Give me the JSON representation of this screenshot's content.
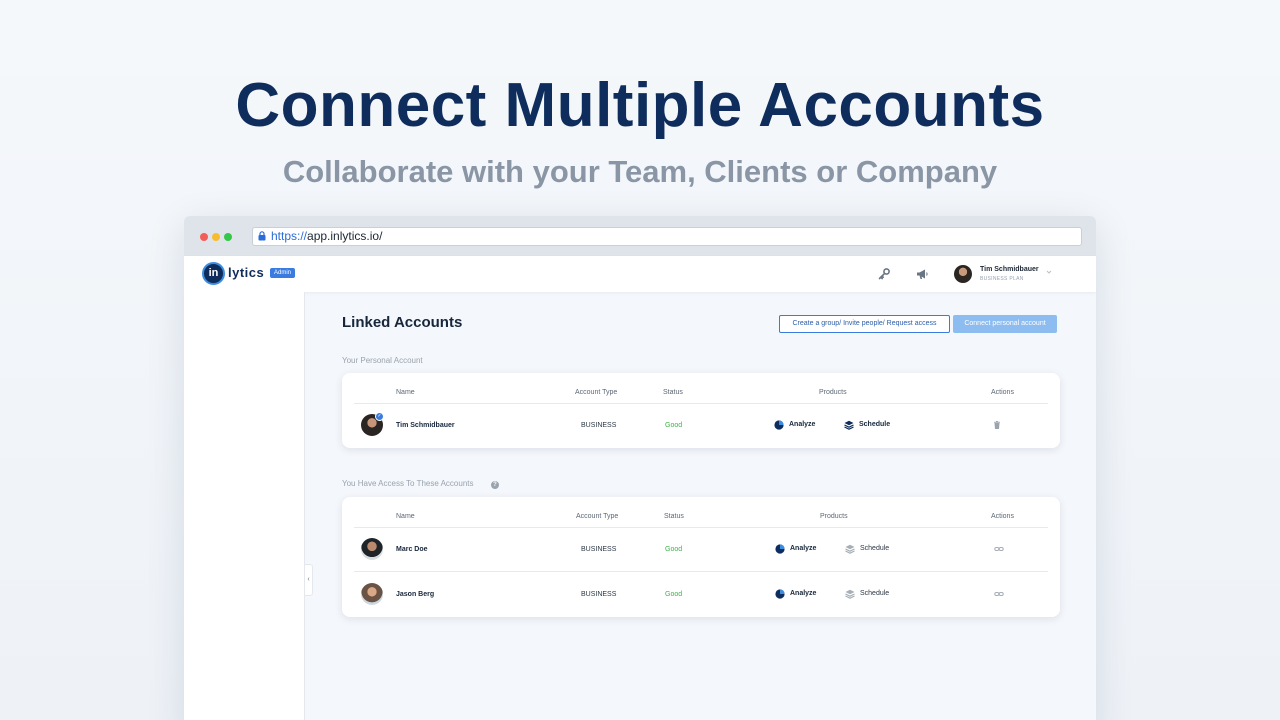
{
  "hero": {
    "title": "Connect Multiple Accounts",
    "subtitle": "Collaborate with your Team, Clients or Company"
  },
  "browser": {
    "url_scheme": "https://",
    "url_rest": "app.inlytics.io/"
  },
  "header": {
    "logo_mark": "in",
    "logo_text": "lytics",
    "badge": "Admin",
    "icons": [
      "key-icon",
      "megaphone-icon"
    ],
    "user": {
      "name": "Tim Schmidbauer",
      "plan": "BUSINESS PLAN"
    }
  },
  "sidebar": {
    "collapse_glyph": "‹"
  },
  "main": {
    "title": "Linked Accounts",
    "actions": {
      "group_invite": "Create a group/ Invite people/ Request access",
      "connect": "Connect personal account"
    },
    "personal": {
      "label": "Your Personal Account",
      "columns": [
        "Name",
        "Account Type",
        "Status",
        "Products",
        "Actions"
      ],
      "rows": [
        {
          "name": "Tim Schmidbauer",
          "type": "BUSINESS",
          "status": "Good",
          "products": [
            "Analyze",
            "Schedule"
          ],
          "action_icon": "trash-icon"
        }
      ]
    },
    "shared": {
      "label": "You Have Access To These Accounts",
      "help_glyph": "?",
      "columns": [
        "Name",
        "Account Type",
        "Status",
        "Products",
        "Actions"
      ],
      "rows": [
        {
          "name": "Marc Doe",
          "type": "BUSINESS",
          "status": "Good",
          "products": [
            "Analyze",
            "Schedule"
          ],
          "action_icon": "unlink-icon"
        },
        {
          "name": "Jason Berg",
          "type": "BUSINESS",
          "status": "Good",
          "products": [
            "Analyze",
            "Schedule"
          ],
          "action_icon": "unlink-icon"
        }
      ]
    }
  },
  "colors": {
    "brand_navy": "#0f2d5c",
    "accent_blue": "#3a7be0",
    "status_good": "#3bb34a",
    "subtitle_gray": "#8a96a5"
  }
}
